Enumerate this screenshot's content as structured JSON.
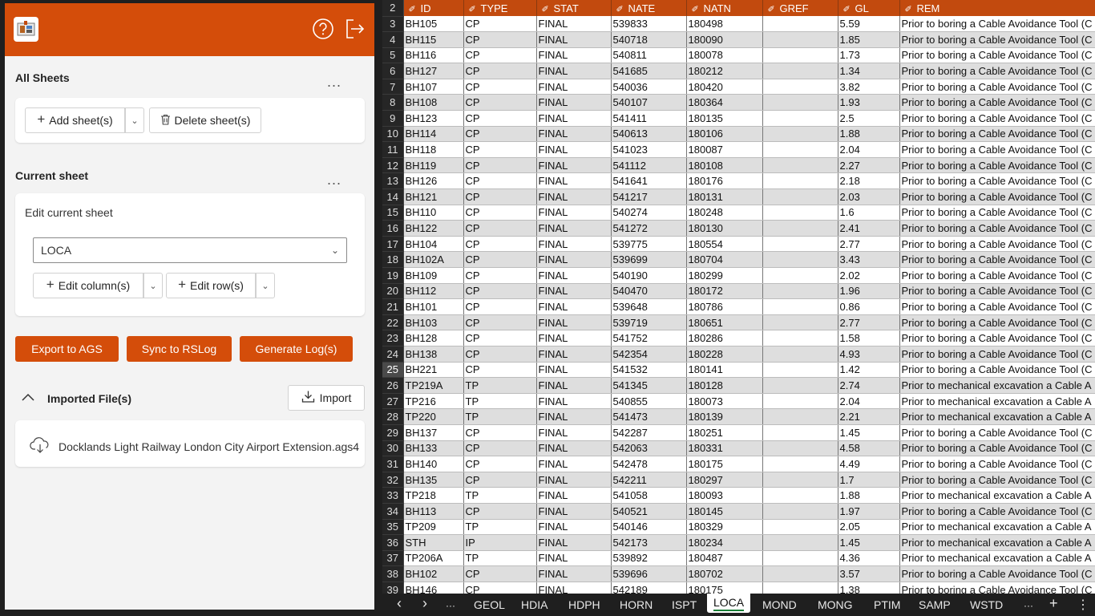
{
  "header": {
    "logo_icon": "app-logo-icon",
    "help_icon": "help-icon",
    "signout_icon": "sign-out-icon",
    "accent": "#d44d0a"
  },
  "all_sheets": {
    "title": "All Sheets",
    "more": "...",
    "add_label": "Add sheet(s)",
    "delete_label": "Delete sheet(s)"
  },
  "current_sheet": {
    "title": "Current sheet",
    "more": "...",
    "edit_label": "Edit current sheet",
    "selected": "LOCA",
    "edit_columns_label": "Edit column(s)",
    "edit_rows_label": "Edit row(s)"
  },
  "actions": {
    "export": "Export to AGS",
    "sync": "Sync to RSLog",
    "generate": "Generate Log(s)"
  },
  "imported": {
    "title": "Imported File(s)",
    "import_label": "Import",
    "file_name": "Docklands Light Railway London City Airport Extension.ags4"
  },
  "sheet": {
    "header_row_number": "2",
    "columns": [
      "ID",
      "TYPE",
      "STAT",
      "NATE",
      "NATN",
      "GREF",
      "GL",
      "REM"
    ],
    "active_row": "25",
    "rows": [
      [
        "3",
        "BH105",
        "CP",
        "FINAL",
        "539833",
        "180498",
        "",
        "5.59",
        "Prior to boring a Cable Avoidance Tool (C"
      ],
      [
        "4",
        "BH115",
        "CP",
        "FINAL",
        "540718",
        "180090",
        "",
        "1.85",
        "Prior to boring a Cable Avoidance Tool (C"
      ],
      [
        "5",
        "BH116",
        "CP",
        "FINAL",
        "540811",
        "180078",
        "",
        "1.73",
        "Prior to boring a Cable Avoidance Tool (C"
      ],
      [
        "6",
        "BH127",
        "CP",
        "FINAL",
        "541685",
        "180212",
        "",
        "1.34",
        "Prior to boring a Cable Avoidance Tool (C"
      ],
      [
        "7",
        "BH107",
        "CP",
        "FINAL",
        "540036",
        "180420",
        "",
        "3.82",
        "Prior to boring a Cable Avoidance Tool (C"
      ],
      [
        "8",
        "BH108",
        "CP",
        "FINAL",
        "540107",
        "180364",
        "",
        "1.93",
        "Prior to boring a Cable Avoidance Tool (C"
      ],
      [
        "9",
        "BH123",
        "CP",
        "FINAL",
        "541411",
        "180135",
        "",
        "2.5",
        "Prior to boring a Cable Avoidance Tool (C"
      ],
      [
        "10",
        "BH114",
        "CP",
        "FINAL",
        "540613",
        "180106",
        "",
        "1.88",
        "Prior to boring a Cable Avoidance Tool (C"
      ],
      [
        "11",
        "BH118",
        "CP",
        "FINAL",
        "541023",
        "180087",
        "",
        "2.04",
        "Prior to boring a Cable Avoidance Tool (C"
      ],
      [
        "12",
        "BH119",
        "CP",
        "FINAL",
        "541112",
        "180108",
        "",
        "2.27",
        "Prior to boring a Cable Avoidance Tool (C"
      ],
      [
        "13",
        "BH126",
        "CP",
        "FINAL",
        "541641",
        "180176",
        "",
        "2.18",
        "Prior to boring a Cable Avoidance Tool (C"
      ],
      [
        "14",
        "BH121",
        "CP",
        "FINAL",
        "541217",
        "180131",
        "",
        "2.03",
        "Prior to boring a Cable Avoidance Tool (C"
      ],
      [
        "15",
        "BH110",
        "CP",
        "FINAL",
        "540274",
        "180248",
        "",
        "1.6",
        "Prior to boring a Cable Avoidance Tool (C"
      ],
      [
        "16",
        "BH122",
        "CP",
        "FINAL",
        "541272",
        "180130",
        "",
        "2.41",
        "Prior to boring a Cable Avoidance Tool (C"
      ],
      [
        "17",
        "BH104",
        "CP",
        "FINAL",
        "539775",
        "180554",
        "",
        "2.77",
        "Prior to boring a Cable Avoidance Tool (C"
      ],
      [
        "18",
        "BH102A",
        "CP",
        "FINAL",
        "539699",
        "180704",
        "",
        "3.43",
        "Prior to boring a Cable Avoidance Tool (C"
      ],
      [
        "19",
        "BH109",
        "CP",
        "FINAL",
        "540190",
        "180299",
        "",
        "2.02",
        "Prior to boring a Cable Avoidance Tool (C"
      ],
      [
        "20",
        "BH112",
        "CP",
        "FINAL",
        "540470",
        "180172",
        "",
        "1.96",
        "Prior to boring a Cable Avoidance Tool (C"
      ],
      [
        "21",
        "BH101",
        "CP",
        "FINAL",
        "539648",
        "180786",
        "",
        "0.86",
        "Prior to boring a Cable Avoidance Tool (C"
      ],
      [
        "22",
        "BH103",
        "CP",
        "FINAL",
        "539719",
        "180651",
        "",
        "2.77",
        "Prior to boring a Cable Avoidance Tool (C"
      ],
      [
        "23",
        "BH128",
        "CP",
        "FINAL",
        "541752",
        "180286",
        "",
        "1.58",
        "Prior to boring a Cable Avoidance Tool (C"
      ],
      [
        "24",
        "BH138",
        "CP",
        "FINAL",
        "542354",
        "180228",
        "",
        "4.93",
        "Prior to boring a Cable Avoidance Tool (C"
      ],
      [
        "25",
        "BH221",
        "CP",
        "FINAL",
        "541532",
        "180141",
        "",
        "1.42",
        "Prior to boring a Cable Avoidance Tool (C"
      ],
      [
        "26",
        "TP219A",
        "TP",
        "FINAL",
        "541345",
        "180128",
        "",
        "2.74",
        "Prior to mechanical excavation a Cable A"
      ],
      [
        "27",
        "TP216",
        "TP",
        "FINAL",
        "540855",
        "180073",
        "",
        "2.04",
        "Prior to mechanical excavation a Cable A"
      ],
      [
        "28",
        "TP220",
        "TP",
        "FINAL",
        "541473",
        "180139",
        "",
        "2.21",
        "Prior to mechanical excavation a Cable A"
      ],
      [
        "29",
        "BH137",
        "CP",
        "FINAL",
        "542287",
        "180251",
        "",
        "1.45",
        "Prior to boring a Cable Avoidance Tool (C"
      ],
      [
        "30",
        "BH133",
        "CP",
        "FINAL",
        "542063",
        "180331",
        "",
        "4.58",
        "Prior to boring a Cable Avoidance Tool (C"
      ],
      [
        "31",
        "BH140",
        "CP",
        "FINAL",
        "542478",
        "180175",
        "",
        "4.49",
        "Prior to boring a Cable Avoidance Tool (C"
      ],
      [
        "32",
        "BH135",
        "CP",
        "FINAL",
        "542211",
        "180297",
        "",
        "1.7",
        "Prior to boring a Cable Avoidance Tool (C"
      ],
      [
        "33",
        "TP218",
        "TP",
        "FINAL",
        "541058",
        "180093",
        "",
        "1.88",
        "Prior to mechanical excavation a Cable A"
      ],
      [
        "34",
        "BH113",
        "CP",
        "FINAL",
        "540521",
        "180145",
        "",
        "1.97",
        "Prior to boring a Cable Avoidance Tool (C"
      ],
      [
        "35",
        "TP209",
        "TP",
        "FINAL",
        "540146",
        "180329",
        "",
        "2.05",
        "Prior to mechanical excavation a Cable A"
      ],
      [
        "36",
        "STH",
        "IP",
        "FINAL",
        "542173",
        "180234",
        "",
        "1.45",
        "Prior to mechanical excavation a Cable A"
      ],
      [
        "37",
        "TP206A",
        "TP",
        "FINAL",
        "539892",
        "180487",
        "",
        "4.36",
        "Prior to mechanical excavation a Cable A"
      ],
      [
        "38",
        "BH102",
        "CP",
        "FINAL",
        "539696",
        "180702",
        "",
        "3.57",
        "Prior to boring a Cable Avoidance Tool (C"
      ],
      [
        "39",
        "BH146",
        "CP",
        "FINAL",
        "542189",
        "180175",
        "",
        "1.38",
        "Prior to boring a Cable Avoidance Tool (C"
      ]
    ]
  },
  "tabs": {
    "prev": "‹",
    "next": "›",
    "overflow": "···",
    "items": [
      "GEOL",
      "HDIA",
      "HDPH",
      "HORN",
      "ISPT",
      "LOCA",
      "MOND",
      "MONG",
      "PTIM",
      "SAMP",
      "WSTD"
    ],
    "active": "LOCA",
    "overflow_right": "···",
    "add": "+",
    "menu": "⋮"
  }
}
